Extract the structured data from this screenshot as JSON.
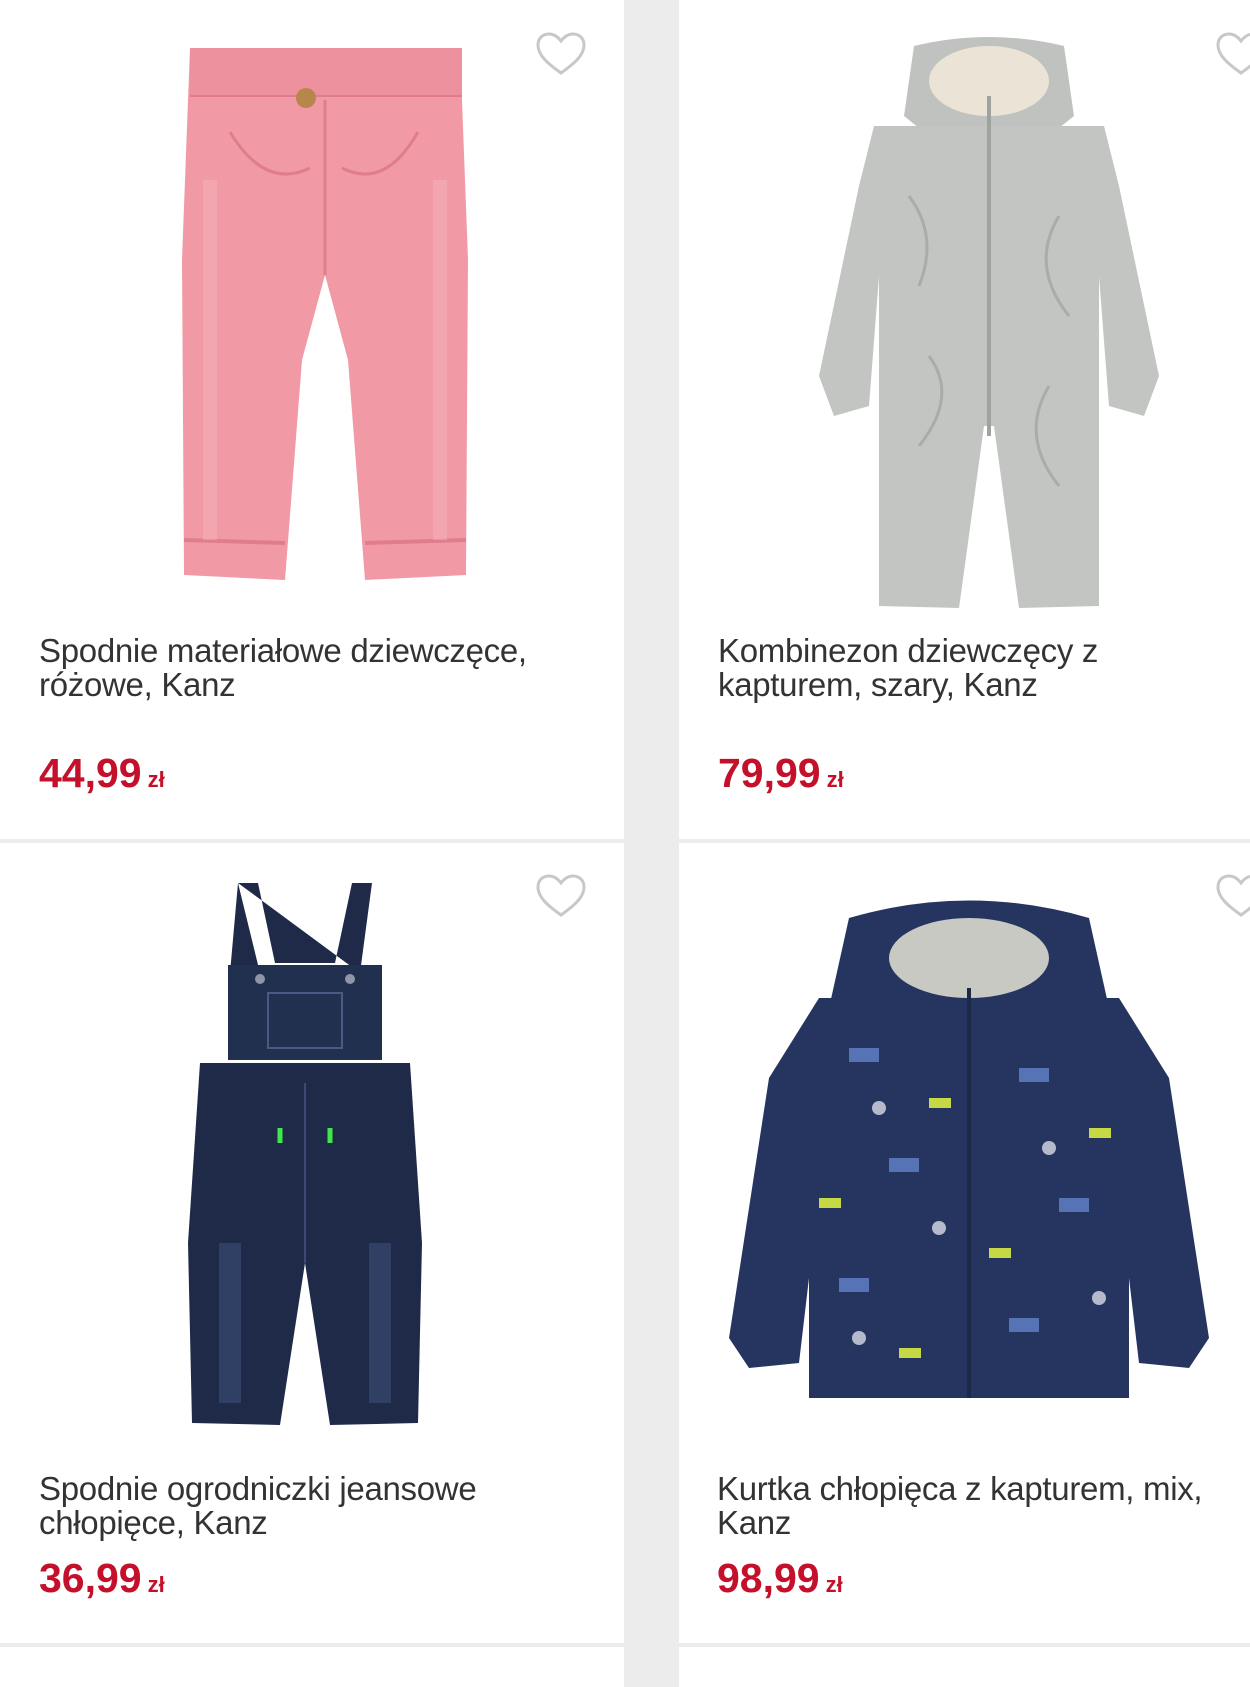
{
  "products": [
    {
      "title": "Spodnie materiałowe dziewczęce, różowe, Kanz",
      "price": "44,99",
      "currency": "zł",
      "image_icon": "pink-corduroy-pants-image",
      "colors": {
        "main": "#f19aa6",
        "shade": "#e6848f"
      }
    },
    {
      "title": "Kombinezon dziewczęcy z kapturem, szary, Kanz",
      "price": "79,99",
      "currency": "zł",
      "image_icon": "grey-hooded-snowsuit-image",
      "colors": {
        "main": "#c2c5c2",
        "shade": "#a7aaa7"
      }
    },
    {
      "title": "Spodnie ogrodniczki jeansowe chłopięce, Kanz",
      "price": "36,99",
      "currency": "zł",
      "image_icon": "denim-dungarees-image",
      "colors": {
        "main": "#1e2a48",
        "shade": "#2e3c5e"
      }
    },
    {
      "title": "Kurtka chłopięca z kapturem, mix, Kanz",
      "price": "98,99",
      "currency": "zł",
      "image_icon": "navy-print-jacket-image",
      "colors": {
        "main": "#253560",
        "shade": "#33467a"
      }
    }
  ],
  "theme": {
    "price_color": "#c4102a",
    "text_color": "#333333",
    "background": "#ececec"
  },
  "icons": {
    "wishlist": "heart-outline-icon"
  }
}
